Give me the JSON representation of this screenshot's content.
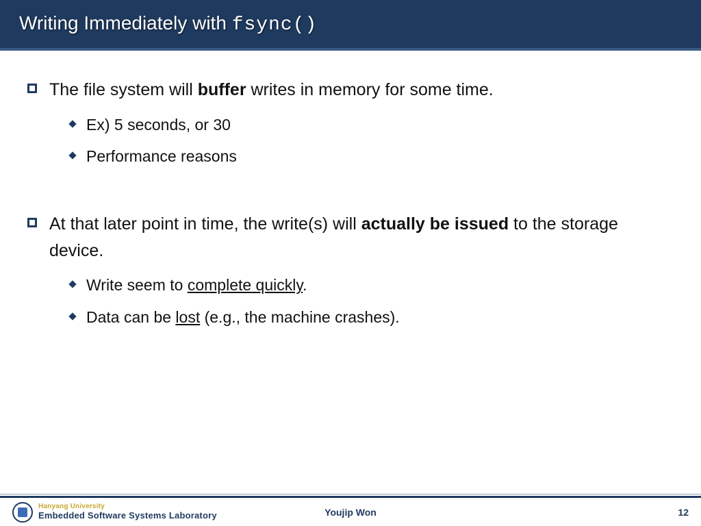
{
  "title_prefix": "Writing Immediately with ",
  "title_code": "fsync()",
  "bullets": [
    {
      "pre": "The file system will ",
      "bold": "buffer",
      "post": " writes in memory for some time.",
      "sub": [
        "Ex) 5 seconds, or 30",
        "Performance reasons"
      ]
    },
    {
      "pre": "At that later point in time, the write(s) will ",
      "bold": "actually be issued",
      "post": " to the storage device.",
      "sub": [
        {
          "pre": "Write seem to ",
          "u": "complete quickly",
          "post": "."
        },
        {
          "pre": "Data can be ",
          "u": "lost",
          "post": " (e.g., the machine crashes)."
        }
      ]
    }
  ],
  "footer": {
    "org_line1": "Hanyang University",
    "org_line2": "Embedded Software Systems Laboratory",
    "author": "Youjip Won",
    "page": "12"
  }
}
